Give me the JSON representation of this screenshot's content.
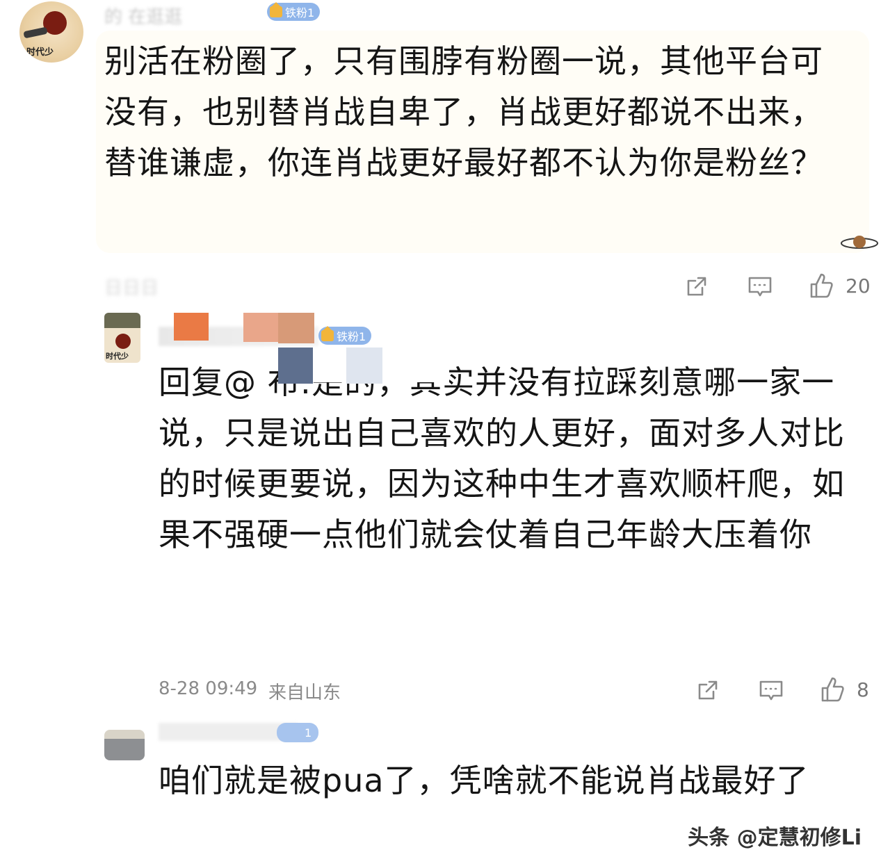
{
  "comments": [
    {
      "avatar_caption": "时代少",
      "username": "的 在逛逛",
      "badge": "铁粉1",
      "text": "别活在粉圈了，只有围脖有粉圈一说，其他平台可没有，也别替肖战自卑了，肖战更好都说不出来，替谁谦虚，你连肖战更好最好都不认为你是粉丝？",
      "meta": "日日日",
      "like_count": "20"
    },
    {
      "avatar_caption": "时代少",
      "username": "",
      "badge": "铁粉1",
      "text": "回复@            布:是的，其实并没有拉踩刻意哪一家一说，只是说出自己喜欢的人更好，面对多人对比的时候更要说，因为这种中生才喜欢顺杆爬，如果不强硬一点他们就会仗着自己年龄大压着你",
      "time": "8-28 09:49",
      "location": "来自山东",
      "like_count": "8"
    },
    {
      "username": "",
      "badge": "1",
      "text": "咱们就是被pua了，凭啥就不能说肖战最好了"
    }
  ],
  "watermark": "头条 @定慧初修Li",
  "icons": {
    "share": "share-icon",
    "reply": "comment-icon",
    "like": "thumbs-up-icon"
  }
}
